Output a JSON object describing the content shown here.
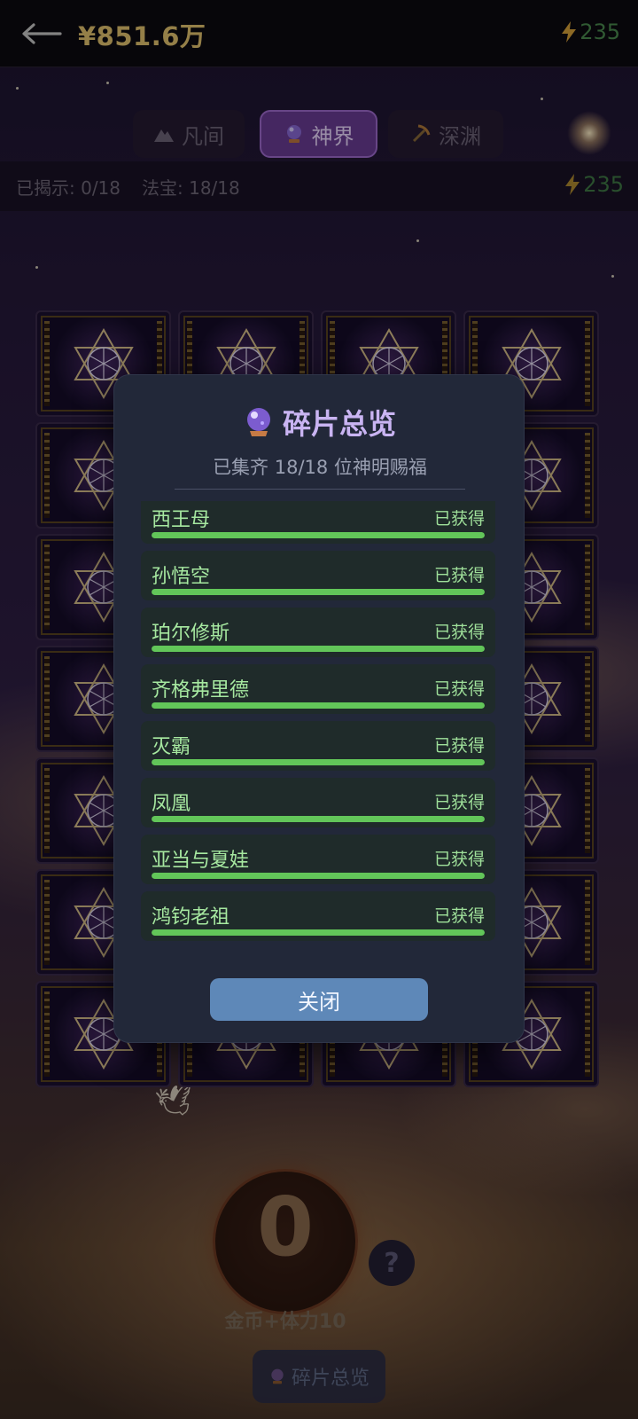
{
  "header": {
    "balance": "¥851.6万",
    "energy": "235"
  },
  "realm_tabs": [
    {
      "label": "凡间",
      "icon": "mountain-icon",
      "active": false
    },
    {
      "label": "神界",
      "icon": "crystal-ball-icon",
      "active": true
    },
    {
      "label": "深渊",
      "icon": "pickaxe-icon",
      "active": false
    }
  ],
  "stats": {
    "revealed": "已揭示: 0/18",
    "treasures": "法宝: 18/18",
    "energy": "235"
  },
  "game": {
    "coin_count": "0",
    "coin_caption": "金币+体力10",
    "help_label": "?",
    "overview_button": "碎片总览"
  },
  "modal": {
    "title": "碎片总览",
    "subtitle": "已集齐 18/18 位神明赐福",
    "close_label": "关闭",
    "items": [
      {
        "name": "西王母",
        "status": "已获得",
        "progress": 1.0
      },
      {
        "name": "孙悟空",
        "status": "已获得",
        "progress": 1.0
      },
      {
        "name": "珀尔修斯",
        "status": "已获得",
        "progress": 1.0
      },
      {
        "name": "齐格弗里德",
        "status": "已获得",
        "progress": 1.0
      },
      {
        "name": "灭霸",
        "status": "已获得",
        "progress": 1.0
      },
      {
        "name": "凤凰",
        "status": "已获得",
        "progress": 1.0
      },
      {
        "name": "亚当与夏娃",
        "status": "已获得",
        "progress": 1.0
      },
      {
        "name": "鸿钧老祖",
        "status": "已获得",
        "progress": 1.0
      }
    ]
  },
  "colors": {
    "gold": "#e3c36f",
    "energy_green": "#4b8a4f",
    "active_tab": "#6b3c96",
    "progress_green": "#62c659",
    "close_button": "#5e88b8"
  }
}
